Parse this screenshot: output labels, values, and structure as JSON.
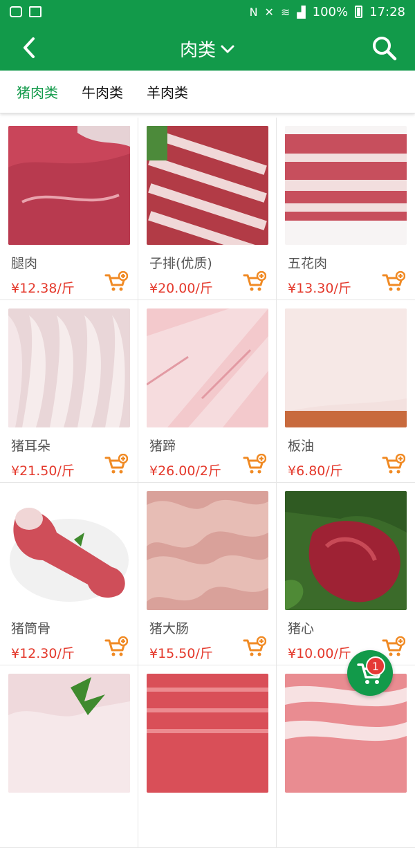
{
  "status_bar": {
    "battery": "100%",
    "time": "17:28"
  },
  "header": {
    "title": "肉类",
    "back_icon": "chevron-left-icon",
    "search_icon": "search-icon",
    "dropdown_icon": "chevron-down-icon"
  },
  "tabs": [
    {
      "label": "猪肉类",
      "active": true
    },
    {
      "label": "牛肉类",
      "active": false
    },
    {
      "label": "羊肉类",
      "active": false
    }
  ],
  "products": [
    {
      "name": "腿肉",
      "price": "¥12.38/斤"
    },
    {
      "name": "子排(优质)",
      "price": "¥20.00/斤"
    },
    {
      "name": "五花肉",
      "price": "¥13.30/斤"
    },
    {
      "name": "猪耳朵",
      "price": "¥21.50/斤"
    },
    {
      "name": "猪蹄",
      "price": "¥26.00/2斤"
    },
    {
      "name": "板油",
      "price": "¥6.80/斤"
    },
    {
      "name": "猪筒骨",
      "price": "¥12.30/斤"
    },
    {
      "name": "猪大肠",
      "price": "¥15.50/斤"
    },
    {
      "name": "猪心",
      "price": "¥10.00/斤"
    },
    {
      "name": "",
      "price": ""
    },
    {
      "name": "",
      "price": ""
    },
    {
      "name": "",
      "price": ""
    }
  ],
  "cart": {
    "count": "1",
    "icon": "shopping-cart-icon"
  },
  "colors": {
    "brand_green": "#129a4a",
    "price_red": "#e4392c",
    "cart_orange": "#f08a24"
  }
}
